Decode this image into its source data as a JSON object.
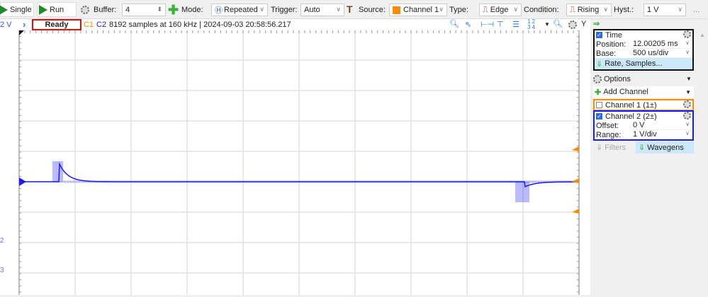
{
  "toolbar": {
    "single": "Single",
    "run": "Run",
    "buffer_label": "Buffer:",
    "buffer_value": "4",
    "mode_label": "Mode:",
    "mode_value": "Repeated",
    "trigger_label": "Trigger:",
    "trigger_value": "Auto",
    "source_label": "Source:",
    "source_value": "Channel 1",
    "type_label": "Type:",
    "type_value": "Edge",
    "condition_label": "Condition:",
    "condition_value": "Rising",
    "hyst_label": "Hyst.:",
    "hyst_value": "1 V",
    "more": "..."
  },
  "status": {
    "axis_unit": "2 V",
    "state": "Ready",
    "c1": "C1",
    "c2": "C2",
    "info": "8192 samples at 160 kHz  | 2024-09-03 20:58:56.217",
    "y_button": "Y"
  },
  "axis": {
    "labels": [
      "2",
      "3"
    ]
  },
  "time": {
    "title": "Time",
    "position_label": "Position:",
    "position_value": "12.00205 ms",
    "base_label": "Base:",
    "base_value": "500 us/div",
    "rate_button": "Rate, Samples..."
  },
  "options": "Options",
  "add_channel": "Add Channel",
  "channel1": {
    "title": "Channel 1 (1±)"
  },
  "channel2": {
    "title": "Channel 2 (2±)",
    "offset_label": "Offset:",
    "offset_value": "0 V",
    "range_label": "Range:",
    "range_value": "1 V/div"
  },
  "tabs": {
    "filters": "Filters",
    "wavegens": "Wavegens"
  },
  "colors": {
    "channel1": "#ff8c00",
    "channel2": "#1a1aff",
    "run": "#1e8c2a",
    "status_border": "#e01010"
  }
}
